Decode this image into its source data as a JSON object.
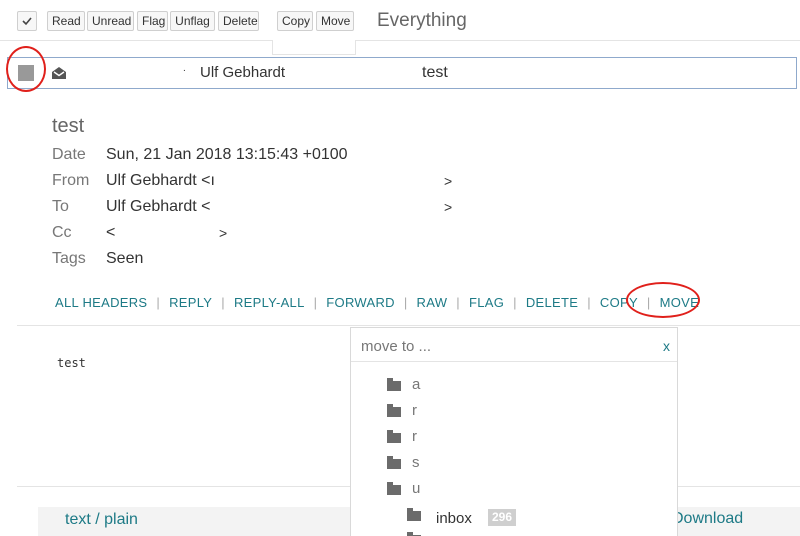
{
  "toolbar": {
    "buttons": [
      "Read",
      "Unread",
      "Flag",
      "Unflag",
      "Delete",
      "Copy",
      "Move"
    ],
    "context_title": "Everything"
  },
  "message_row": {
    "dot": ".",
    "from": "Ulf Gebhardt",
    "subject": "test"
  },
  "message": {
    "subject": "test",
    "headers": [
      {
        "label": "Date",
        "value": "Sun, 21 Jan 2018 13:15:43 +0100"
      },
      {
        "label": "From",
        "value": "Ulf Gebhardt <ı",
        "suffix": ">"
      },
      {
        "label": "To",
        "value": "Ulf Gebhardt <",
        "suffix": ">"
      },
      {
        "label": "Cc",
        "value": "<",
        "suffix": ">"
      },
      {
        "label": "Tags",
        "value": "Seen"
      }
    ],
    "actions": [
      "ALL HEADERS",
      "REPLY",
      "REPLY-ALL",
      "FORWARD",
      "RAW",
      "FLAG",
      "DELETE",
      "COPY",
      "MOVE"
    ],
    "body": "test",
    "attachment": {
      "name": "text / plain",
      "download": "Download"
    }
  },
  "move_popup": {
    "placeholder": "move to ...",
    "close": "x",
    "folders": [
      "a",
      "r",
      "r",
      "s",
      "u"
    ],
    "inbox": {
      "label": "inbox",
      "count": "296"
    }
  },
  "colors": {
    "link": "#1d7a86",
    "annotation": "#e0201b",
    "selected_border": "#8fa9cc"
  },
  "icons": [
    "checkmark-icon",
    "envelope-open-icon",
    "folder-icon"
  ]
}
